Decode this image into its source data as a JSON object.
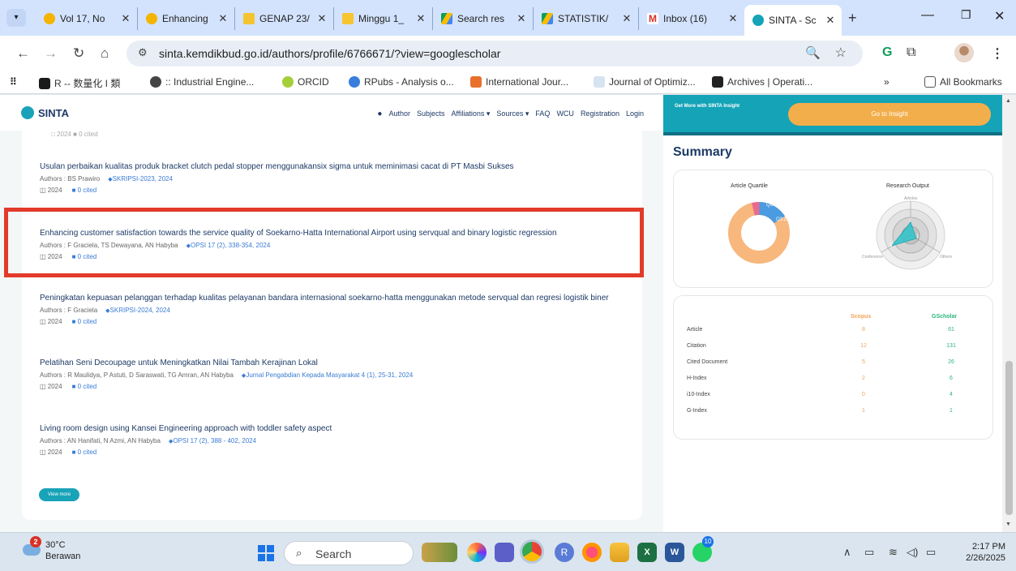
{
  "browser": {
    "tabs": [
      {
        "title": "Vol 17, No",
        "active": false
      },
      {
        "title": "Enhancing",
        "active": false
      },
      {
        "title": "GENAP 23/",
        "active": false
      },
      {
        "title": "Minggu 1_",
        "active": false
      },
      {
        "title": "Search res",
        "active": false
      },
      {
        "title": "STATISTIK/",
        "active": false
      },
      {
        "title": "Inbox (16)",
        "active": false
      },
      {
        "title": "SINTA - Sc",
        "active": true
      }
    ],
    "url": "sinta.kemdikbud.go.id/authors/profile/6766671/?view=googlescholar",
    "bookmarks": [
      "R -- 数量化 I 類",
      ":: Industrial Engine...",
      "ORCID",
      "RPubs - Analysis o...",
      "International Jour...",
      "Journal of Optimiz...",
      "Archives | Operati..."
    ],
    "all_bookmarks": "All Bookmarks",
    "overflow": "»"
  },
  "sinta": {
    "logo": "SINTA",
    "nav": [
      "Author",
      "Subjects",
      "Affiliations ▾",
      "Sources ▾",
      "FAQ",
      "WCU",
      "Registration",
      "Login"
    ],
    "prev_cited": "□ 2024   ■ 0 cited",
    "publications": [
      {
        "title": "Usulan perbaikan kualitas produk bracket clutch pedal stopper menggunakansix sigma untuk meminimasi cacat di PT Masbi Sukses",
        "authors": "Authors : BS Prawiro",
        "source": "SKRIPSI-2023, 2024",
        "year": "2024",
        "cited": "0 cited"
      },
      {
        "title": "Enhancing customer satisfaction towards the service quality of Soekarno-Hatta International Airport using servqual and binary logistic regression",
        "authors": "Authors : F Graciela, TS Dewayana, AN Habyba",
        "source": "OPSI 17 (2), 338-354, 2024",
        "year": "2024",
        "cited": "0 cited"
      },
      {
        "title": "Peningkatan kepuasan pelanggan terhadap kualitas pelayanan bandara internasional soekarno-hatta menggunakan metode servqual dan regresi logistik biner",
        "authors": "Authors : F Graciela",
        "source": "SKRIPSI-2024, 2024",
        "year": "2024",
        "cited": "0 cited"
      },
      {
        "title": "Pelatihan Seni Decoupage untuk Meningkatkan Nilai Tambah Kerajinan Lokal",
        "authors": "Authors : R Maulidya, P Astuti, D Saraswati, TG Amran, AN Habyba",
        "source": "Jurnal Pengabdian Kepada Masyarakat 4 (1), 25-31, 2024",
        "year": "2024",
        "cited": "0 cited"
      },
      {
        "title": "Living room design using Kansei Engineering approach with toddler safety aspect",
        "authors": "Authors : AN Hanifati, N Azmi, AN Habyba",
        "source": "OPSI 17 (2), 388 - 402, 2024",
        "year": "2024",
        "cited": "0 cited"
      }
    ],
    "view_more": "View more"
  },
  "insight": {
    "text": "Get More with SINTA Insight",
    "button": "Go to Insight"
  },
  "summary": {
    "title": "Summary",
    "quartile_title": "Article Quartile",
    "quartile_labels": {
      "q1": "Q1:2",
      "q2": "Q2:10",
      "q3": "Q3:2",
      "q4": "Q4:6"
    },
    "output_title": "Research Output",
    "output_labels": {
      "articles": "Articles",
      "conference": "Conference",
      "others": "Others",
      "v_articles": "2",
      "v_conference": "5",
      "v_others": "1"
    },
    "stats_headers": {
      "scopus": "Scopus",
      "gscholar": "GScholar"
    },
    "stats": [
      {
        "label": "Article",
        "scopus": "8",
        "gscholar": "61"
      },
      {
        "label": "Citation",
        "scopus": "12",
        "gscholar": "131"
      },
      {
        "label": "Cited Document",
        "scopus": "5",
        "gscholar": "26"
      },
      {
        "label": "H-Index",
        "scopus": "2",
        "gscholar": "6"
      },
      {
        "label": "i10-Index",
        "scopus": "0",
        "gscholar": "4"
      },
      {
        "label": "G-Index",
        "scopus": "1",
        "gscholar": "1"
      }
    ]
  },
  "taskbar": {
    "badge": "2",
    "temp": "30°C",
    "weather": "Berawan",
    "search": "Search",
    "time": "2:17 PM",
    "date": "2/26/2025",
    "whatsapp_badge": "10"
  },
  "colors": {
    "sinta_teal": "#14a3b7",
    "insight_orange": "#f2ae4b",
    "highlight_red": "#e23a2b",
    "scopus_orange": "#f0a35a",
    "gscholar_green": "#2db57a"
  }
}
